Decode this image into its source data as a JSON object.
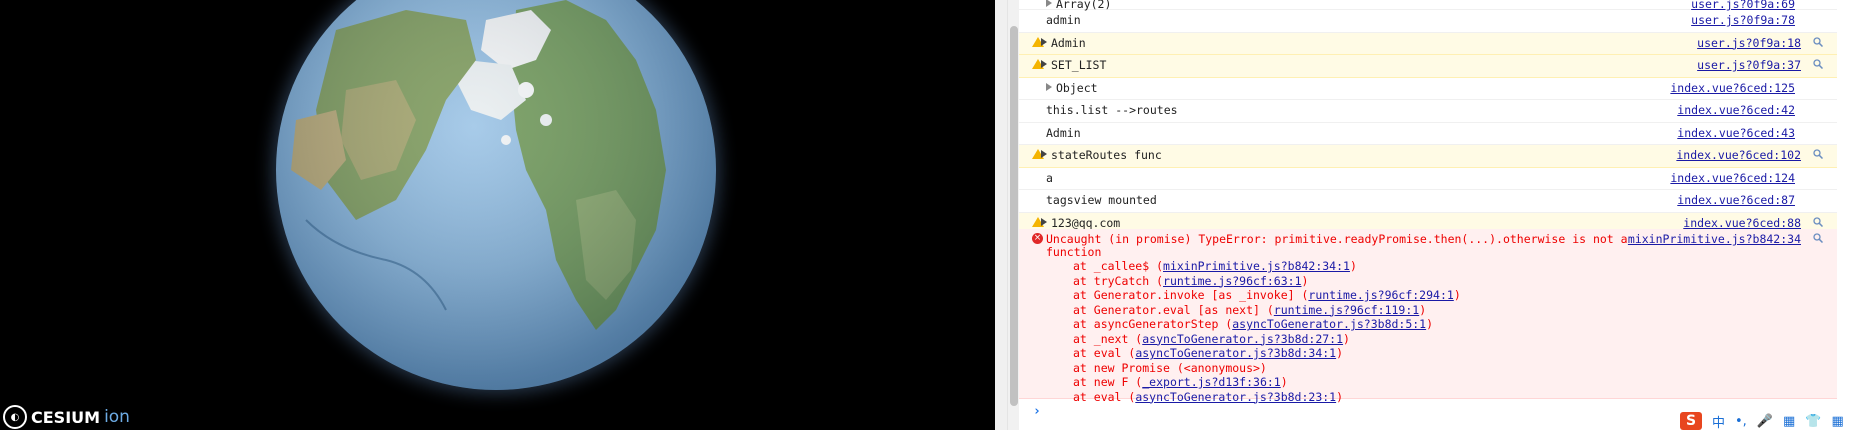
{
  "viewer": {
    "logo_text": "CESIUM",
    "logo_suffix": "ion"
  },
  "console": {
    "rows": [
      {
        "type": "log",
        "expand": true,
        "grey": true,
        "msg": "Array(2)",
        "src": "user.js?0f9a:69"
      },
      {
        "type": "log",
        "expand": false,
        "msg": "admin",
        "src": "user.js?0f9a:78"
      },
      {
        "type": "warn",
        "expand": true,
        "msg": "Admin",
        "src": "user.js?0f9a:18"
      },
      {
        "type": "warn",
        "expand": true,
        "msg": "SET_LIST",
        "src": "user.js?0f9a:37"
      },
      {
        "type": "log",
        "expand": true,
        "grey": true,
        "msg": "Object",
        "src": "index.vue?6ced:125"
      },
      {
        "type": "log",
        "expand": false,
        "msg": "this.list -->routes",
        "src": "index.vue?6ced:42"
      },
      {
        "type": "log",
        "expand": false,
        "msg": "Admin",
        "src": "index.vue?6ced:43"
      },
      {
        "type": "warn",
        "expand": true,
        "msg": "stateRoutes func",
        "src": "index.vue?6ced:102"
      },
      {
        "type": "log",
        "expand": false,
        "msg": "a",
        "src": "index.vue?6ced:124"
      },
      {
        "type": "log",
        "expand": false,
        "msg": "tagsview mounted",
        "src": "index.vue?6ced:87"
      },
      {
        "type": "warn",
        "expand": true,
        "msg": "123@qq.com",
        "src": "index.vue?6ced:88"
      }
    ],
    "error": {
      "line1": "Uncaught (in promise) TypeError: primitive.readyPromise.then(...).otherwise is not a",
      "line2": "function",
      "src": "mixinPrimitive.js?b842:34",
      "stack": [
        {
          "pre": "at _callee$ (",
          "link": "mixinPrimitive.js?b842:34:1",
          "post": ")"
        },
        {
          "pre": "at tryCatch (",
          "link": "runtime.js?96cf:63:1",
          "post": ")"
        },
        {
          "pre": "at Generator.invoke [as _invoke] (",
          "link": "runtime.js?96cf:294:1",
          "post": ")"
        },
        {
          "pre": "at Generator.eval [as next] (",
          "link": "runtime.js?96cf:119:1",
          "post": ")"
        },
        {
          "pre": "at asyncGeneratorStep (",
          "link": "asyncToGenerator.js?3b8d:5:1",
          "post": ")"
        },
        {
          "pre": "at _next (",
          "link": "asyncToGenerator.js?3b8d:27:1",
          "post": ")"
        },
        {
          "pre": "at eval (",
          "link": "asyncToGenerator.js?3b8d:34:1",
          "post": ")"
        },
        {
          "pre": "at new Promise (<anonymous>)",
          "link": "",
          "post": ""
        },
        {
          "pre": "at new F (",
          "link": "_export.js?d13f:36:1",
          "post": ")"
        },
        {
          "pre": "at eval (",
          "link": "asyncToGenerator.js?3b8d:23:1",
          "post": ")"
        }
      ]
    },
    "prompt": "›"
  },
  "tray": {
    "items": [
      "S",
      "中",
      "•,",
      "🎤",
      "▦",
      "👕",
      "▦"
    ]
  }
}
